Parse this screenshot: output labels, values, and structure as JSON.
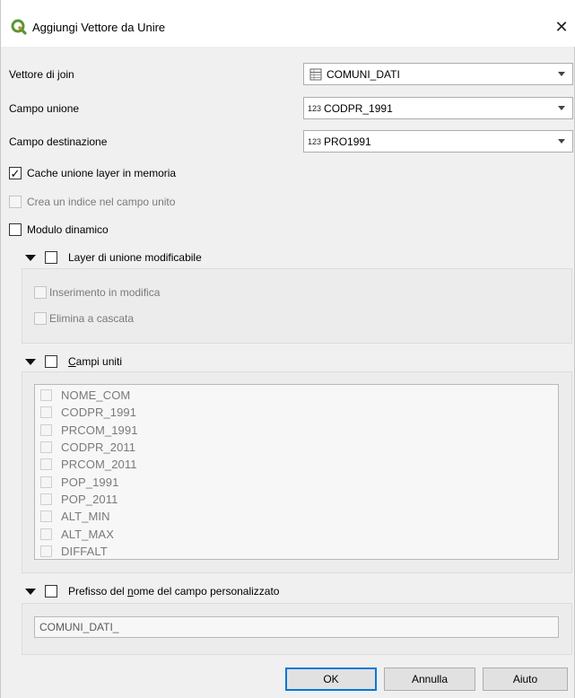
{
  "window": {
    "title": "Aggiungi Vettore da Unire",
    "close_glyph": "✕"
  },
  "form": {
    "join_layer_label": "Vettore di join",
    "join_layer_value": "COMUNI_DATI",
    "join_field_label": "Campo unione",
    "join_field_type": "123",
    "join_field_value": "CODPR_1991",
    "target_field_label": "Campo destinazione",
    "target_field_type": "123",
    "target_field_value": "PRO1991"
  },
  "options": {
    "cache_label": "Cache unione layer in memoria",
    "cache_checked": true,
    "index_label": "Crea un indice nel campo unito",
    "dynamic_label": "Modulo dinamico"
  },
  "editable_group": {
    "title": "Layer di unione modificabile",
    "upsert_label": "Inserimento in modifica",
    "cascade_label": "Elimina a cascata"
  },
  "joined_fields_group": {
    "title_first": "C",
    "title_rest": "ampi uniti",
    "fields": [
      "NOME_COM",
      "CODPR_1991",
      "PRCOM_1991",
      "CODPR_2011",
      "PRCOM_2011",
      "POP_1991",
      "POP_2011",
      "ALT_MIN",
      "ALT_MAX",
      "DIFFALT"
    ]
  },
  "prefix_group": {
    "title_a": "Prefisso del ",
    "title_u": "n",
    "title_b": "ome del campo personalizzato",
    "value": "COMUNI_DATI_"
  },
  "buttons": {
    "ok": "OK",
    "cancel": "Annulla",
    "help": "Aiuto"
  },
  "icons": {
    "app": "qgis-logo-icon",
    "layer": "table-layer-icon",
    "close": "close-icon"
  },
  "colors": {
    "qgis_green": "#589632",
    "qgis_yellow": "#ee7913",
    "default_button_border": "#0078d7"
  }
}
